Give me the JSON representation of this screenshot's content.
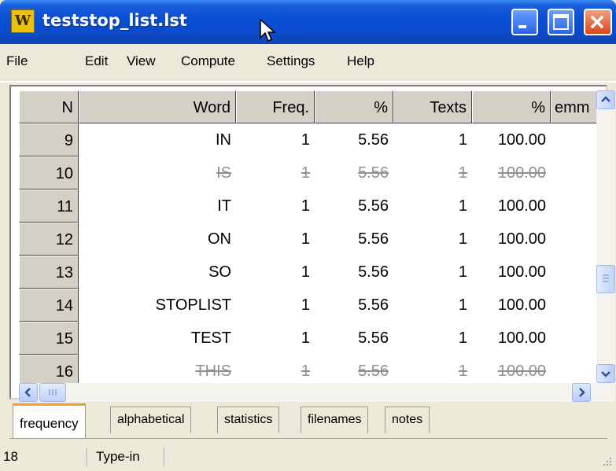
{
  "window": {
    "title": "teststop_list.lst",
    "app_icon_letter": "W"
  },
  "menu": [
    "File",
    "Edit",
    "View",
    "Compute",
    "Settings",
    "Help"
  ],
  "table": {
    "columns": [
      "N",
      "Word",
      "Freq.",
      "%",
      "Texts",
      "%",
      "emm"
    ],
    "rows": [
      {
        "n": "9",
        "word": "IN",
        "freq": "1",
        "pct": "5.56",
        "texts": "1",
        "pct2": "100.00",
        "struck": false
      },
      {
        "n": "10",
        "word": "IS",
        "freq": "1",
        "pct": "5.56",
        "texts": "1",
        "pct2": "100.00",
        "struck": true
      },
      {
        "n": "11",
        "word": "IT",
        "freq": "1",
        "pct": "5.56",
        "texts": "1",
        "pct2": "100.00",
        "struck": false
      },
      {
        "n": "12",
        "word": "ON",
        "freq": "1",
        "pct": "5.56",
        "texts": "1",
        "pct2": "100.00",
        "struck": false
      },
      {
        "n": "13",
        "word": "SO",
        "freq": "1",
        "pct": "5.56",
        "texts": "1",
        "pct2": "100.00",
        "struck": false
      },
      {
        "n": "14",
        "word": "STOPLIST",
        "freq": "1",
        "pct": "5.56",
        "texts": "1",
        "pct2": "100.00",
        "struck": false
      },
      {
        "n": "15",
        "word": "TEST",
        "freq": "1",
        "pct": "5.56",
        "texts": "1",
        "pct2": "100.00",
        "struck": false
      },
      {
        "n": "16",
        "word": "THIS",
        "freq": "1",
        "pct": "5.56",
        "texts": "1",
        "pct2": "100.00",
        "struck": true
      }
    ]
  },
  "tabs": [
    {
      "label": "frequency",
      "active": true
    },
    {
      "label": "alphabetical",
      "active": false
    },
    {
      "label": "statistics",
      "active": false
    },
    {
      "label": "filenames",
      "active": false
    },
    {
      "label": "notes",
      "active": false
    }
  ],
  "status": {
    "count": "18",
    "mode": "Type-in"
  },
  "colors": {
    "titlebar": "#0a4fd4",
    "struck_text": "#909090",
    "active_tab_accent": "#f0a030"
  }
}
